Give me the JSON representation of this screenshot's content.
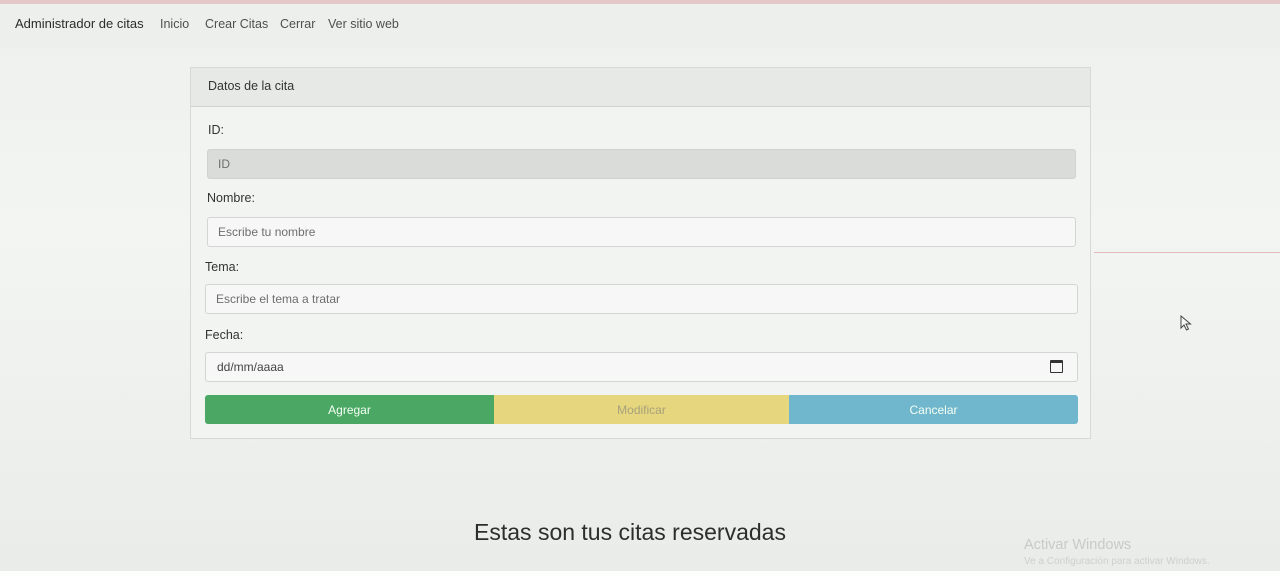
{
  "navbar": {
    "brand": "Administrador de citas",
    "links": [
      "Inicio",
      "Crear Citas",
      "Cerrar",
      "Ver sitio web"
    ]
  },
  "form": {
    "header": "Datos de la cita",
    "id": {
      "label": "ID:",
      "placeholder": "ID"
    },
    "nombre": {
      "label": "Nombre:",
      "placeholder": "Escribe tu nombre"
    },
    "tema": {
      "label": "Tema:",
      "placeholder": "Escribe el tema a tratar"
    },
    "fecha": {
      "label": "Fecha:",
      "placeholder": "dd/mm/aaaa",
      "icon": "calendar-icon"
    },
    "buttons": {
      "agregar": "Agregar",
      "modificar": "Modificar",
      "cancelar": "Cancelar"
    }
  },
  "section_title": "Estas son tus citas reservadas",
  "watermark": {
    "title": "Activar Windows",
    "subtitle": "Ve a Configuración para activar Windows."
  },
  "colors": {
    "agregar": "#4aa764",
    "modificar": "#e6d77f",
    "cancelar": "#70b7cd"
  }
}
